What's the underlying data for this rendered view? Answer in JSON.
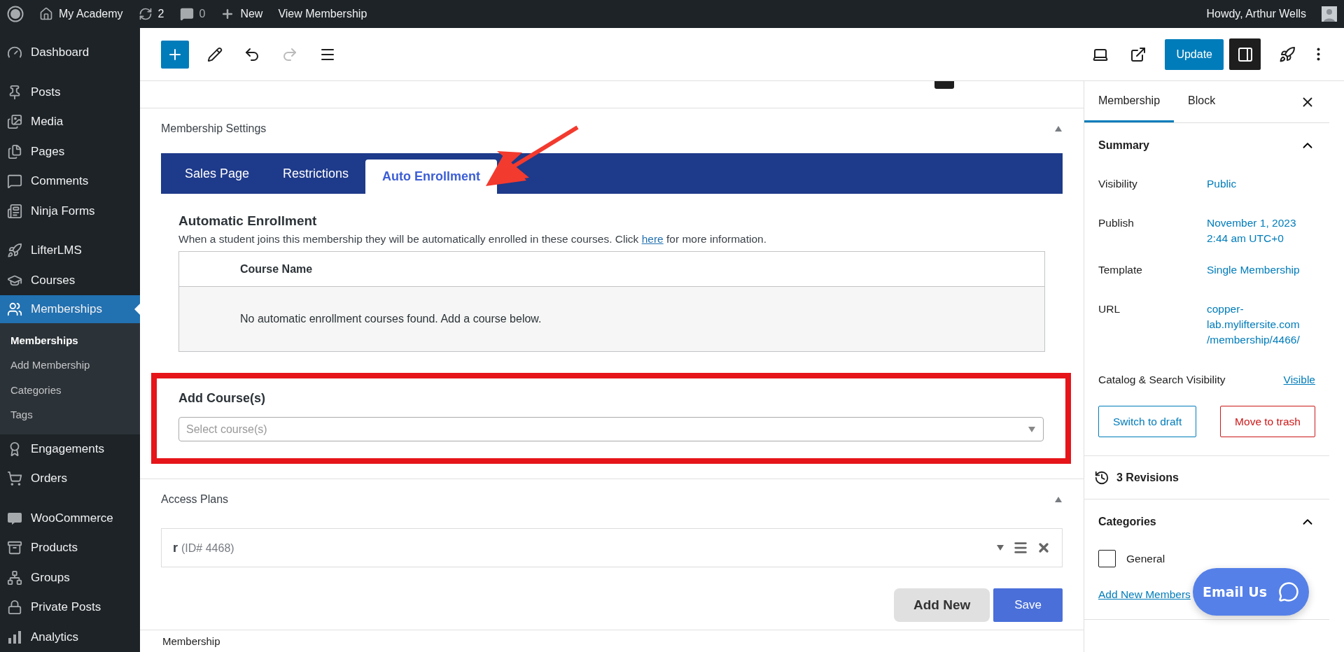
{
  "admin_bar": {
    "site": "My Academy",
    "updates": "2",
    "comments": "0",
    "new": "New",
    "view": "View Membership",
    "greeting": "Howdy, Arthur Wells"
  },
  "sidebar": {
    "items": [
      {
        "label": "Dashboard",
        "selected": false
      },
      {
        "label": "Posts",
        "selected": false
      },
      {
        "label": "Media",
        "selected": false
      },
      {
        "label": "Pages",
        "selected": false
      },
      {
        "label": "Comments",
        "selected": false
      },
      {
        "label": "Ninja Forms",
        "selected": false
      },
      {
        "label": "LifterLMS",
        "selected": false
      },
      {
        "label": "Courses",
        "selected": false
      },
      {
        "label": "Memberships",
        "selected": true,
        "children": [
          {
            "label": "Memberships",
            "selected": true
          },
          {
            "label": "Add Membership",
            "selected": false
          },
          {
            "label": "Categories",
            "selected": false
          },
          {
            "label": "Tags",
            "selected": false
          }
        ]
      },
      {
        "label": "Engagements",
        "selected": false
      },
      {
        "label": "Orders",
        "selected": false
      },
      {
        "label": "WooCommerce",
        "selected": false
      },
      {
        "label": "Products",
        "selected": false
      },
      {
        "label": "Groups",
        "selected": false
      },
      {
        "label": "Private Posts",
        "selected": false
      },
      {
        "label": "Analytics",
        "selected": false
      }
    ]
  },
  "toolbar": {
    "update": "Update"
  },
  "settings": {
    "title": "Membership Settings",
    "tabs": [
      {
        "label": "Sales Page",
        "selected": false
      },
      {
        "label": "Restrictions",
        "selected": false
      },
      {
        "label": "Auto Enrollment",
        "selected": true
      }
    ],
    "heading": "Automatic Enrollment",
    "description_before": "When a student joins this membership they will be automatically enrolled in these courses. Click ",
    "description_link": "here",
    "description_after": " for more information.",
    "columns": [
      "Course Name"
    ],
    "empty": "No automatic enrollment courses found. Add a course below.",
    "add_label": "Add Course(s)",
    "add_placeholder": "Select course(s)"
  },
  "access_plans": {
    "title": "Access Plans",
    "plans": [
      {
        "name": "r",
        "id": "(ID# 4468)"
      }
    ],
    "buttons": [
      {
        "label": "Add New",
        "kind": "secondary"
      },
      {
        "label": "Save",
        "kind": "primary"
      }
    ]
  },
  "footer": {
    "breadcrumb": "Membership"
  },
  "panel": {
    "tabs": [
      {
        "label": "Membership",
        "selected": true
      },
      {
        "label": "Block",
        "selected": false
      }
    ],
    "summary": {
      "title": "Summary",
      "expanded": true,
      "rows": [
        {
          "label": "Visibility",
          "value": "Public",
          "underlined": false
        },
        {
          "label": "Publish",
          "value": "November 1, 2023 2:44 am UTC+0",
          "underlined": false
        },
        {
          "label": "Template",
          "value": "Single Membership",
          "underlined": false
        },
        {
          "label": "URL",
          "value": "copper-lab.myliftersite.com/membership/4466/",
          "underlined": false
        },
        {
          "label": "Catalog & Search Visibility",
          "value": "Visible",
          "underlined": true
        }
      ],
      "buttons": [
        {
          "label": "Switch to draft",
          "kind": "primary"
        },
        {
          "label": "Move to trash",
          "kind": "danger"
        }
      ]
    },
    "revisions": "3 Revisions",
    "categories": {
      "title": "Categories",
      "expanded": true,
      "items": [
        {
          "label": "General",
          "checked": false
        }
      ],
      "add_link": "Add New Members"
    }
  },
  "chat": {
    "label": "Email Us"
  }
}
